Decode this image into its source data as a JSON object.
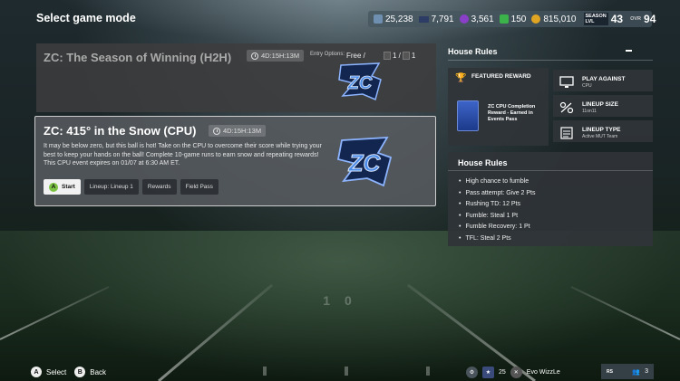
{
  "page": {
    "title": "Select game mode"
  },
  "currencies": {
    "xp": "25,238",
    "coins_alt": "7,791",
    "training": "3,561",
    "points": "150",
    "coins": "815,010"
  },
  "season": {
    "label": "SEASON LVL",
    "level": "43",
    "ovr_label": "OVR",
    "ovr": "94"
  },
  "events": [
    {
      "title": "ZC: The Season of Winning (H2H)",
      "timer": "4D:15H:13M",
      "entry_label": "Entry Options:",
      "entry_value": "Free /",
      "entry_count_a": "1 /",
      "entry_count_b": "1"
    },
    {
      "title": "ZC: 415° in the Snow (CPU)",
      "timer": "4D:15H:13M",
      "description": "It may be below zero, but this ball is hot! Take on the CPU to overcome their score while trying your best to keep your hands on the ball! Complete 10-game runs to earn snow and repeating rewards! This CPU event expires on 01/07 at 6:30 AM ET.",
      "buttons": {
        "start_glyph": "A",
        "start": "Start",
        "lineup": "Lineup: Lineup 1",
        "rewards": "Rewards",
        "field_pass": "Field Pass"
      }
    }
  ],
  "logo": {
    "text": "ZC",
    "color": "#3b7bd6"
  },
  "house_rules_panel": {
    "title": "House Rules",
    "featured": {
      "title": "FEATURED REWARD",
      "description": "ZC CPU Completion Reward - Earned in Events Pass"
    },
    "tiles": [
      {
        "title": "PLAY AGAINST",
        "sub": "CPU"
      },
      {
        "title": "LINEUP SIZE",
        "sub": "11on11"
      },
      {
        "title": "LINEUP TYPE",
        "sub": "Active MUT Team"
      }
    ],
    "rules_title": "House Rules",
    "rules": [
      "High chance to fumble",
      "Pass attempt: Give 2 Pts",
      "Rushing TD: 12 Pts",
      "Fumble: Steal 1 Pt",
      "Fumble Recovery: 1 Pt",
      "TFL: Steal 2 Pts"
    ]
  },
  "footer": {
    "a_glyph": "A",
    "select": "Select",
    "b_glyph": "B",
    "back": "Back",
    "level": "25",
    "gamertag": "Evo WizzLe",
    "rs_label": "RS",
    "party_count": "3"
  },
  "colors": {
    "accent_green": "#7cc243",
    "badge_purple": "#8a3fc9",
    "coin_gold": "#e0a423",
    "points_green": "#3bb34a"
  }
}
